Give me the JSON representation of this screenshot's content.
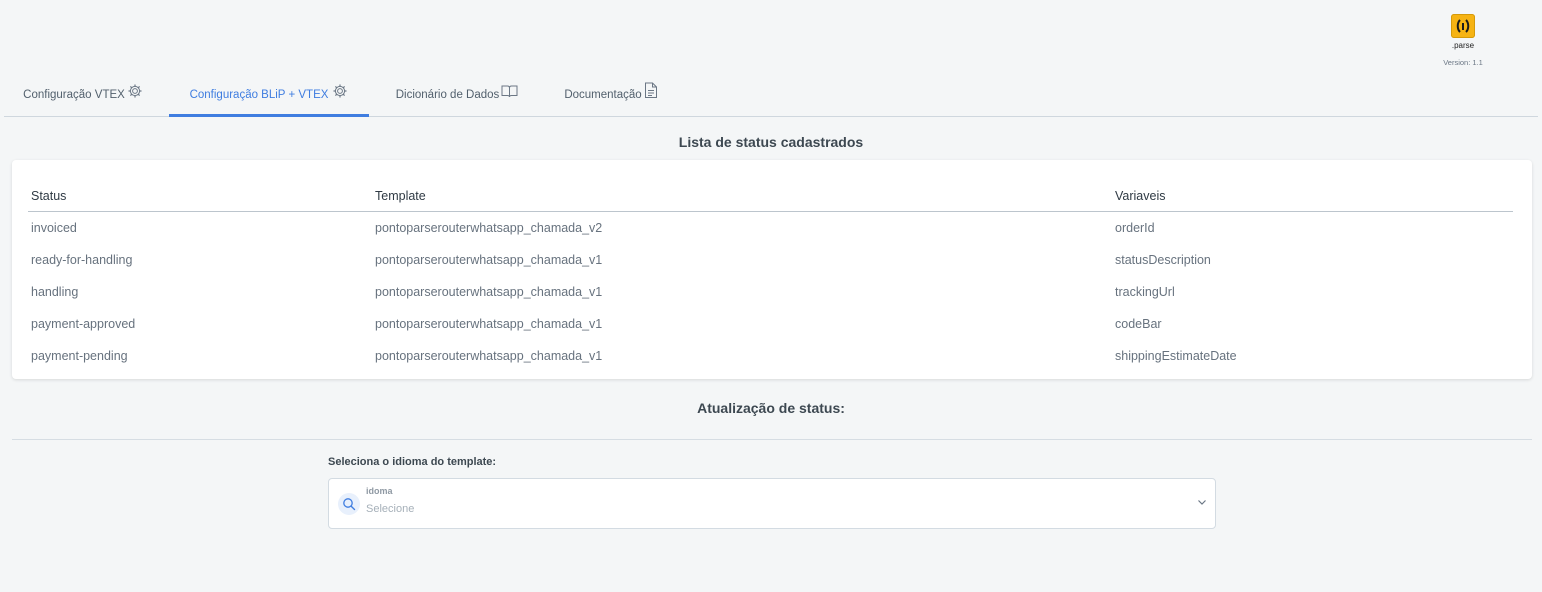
{
  "brand": {
    "logo_text": ".parse",
    "version": "Version: 1.1"
  },
  "tabs": [
    {
      "label": "Configuração VTEX",
      "icon": "gear-icon",
      "active": false
    },
    {
      "label": "Configuração BLiP + VTEX",
      "icon": "gear-icon",
      "active": true
    },
    {
      "label": "Dicionário de Dados",
      "icon": "book-icon",
      "active": false
    },
    {
      "label": "Documentação",
      "icon": "document-icon",
      "active": false
    }
  ],
  "list_title": "Lista de status cadastrados",
  "table": {
    "headers": [
      "Status",
      "Template",
      "Variaveis"
    ],
    "rows": [
      [
        "invoiced",
        "pontoparserouterwhatsapp_chamada_v2",
        "orderId"
      ],
      [
        "ready-for-handling",
        "pontoparserouterwhatsapp_chamada_v1",
        "statusDescription"
      ],
      [
        "handling",
        "pontoparserouterwhatsapp_chamada_v1",
        "trackingUrl"
      ],
      [
        "payment-approved",
        "pontoparserouterwhatsapp_chamada_v1",
        "codeBar"
      ],
      [
        "payment-pending",
        "pontoparserouterwhatsapp_chamada_v1",
        "shippingEstimateDate"
      ]
    ]
  },
  "update_title": "Atualização de status:",
  "language_field": {
    "label": "Seleciona o idioma do template:",
    "select_label": "idoma",
    "placeholder": "Selecione"
  },
  "colors": {
    "accent": "#3f7de0",
    "logo": "#f6b313",
    "background": "#f4f6f7"
  }
}
